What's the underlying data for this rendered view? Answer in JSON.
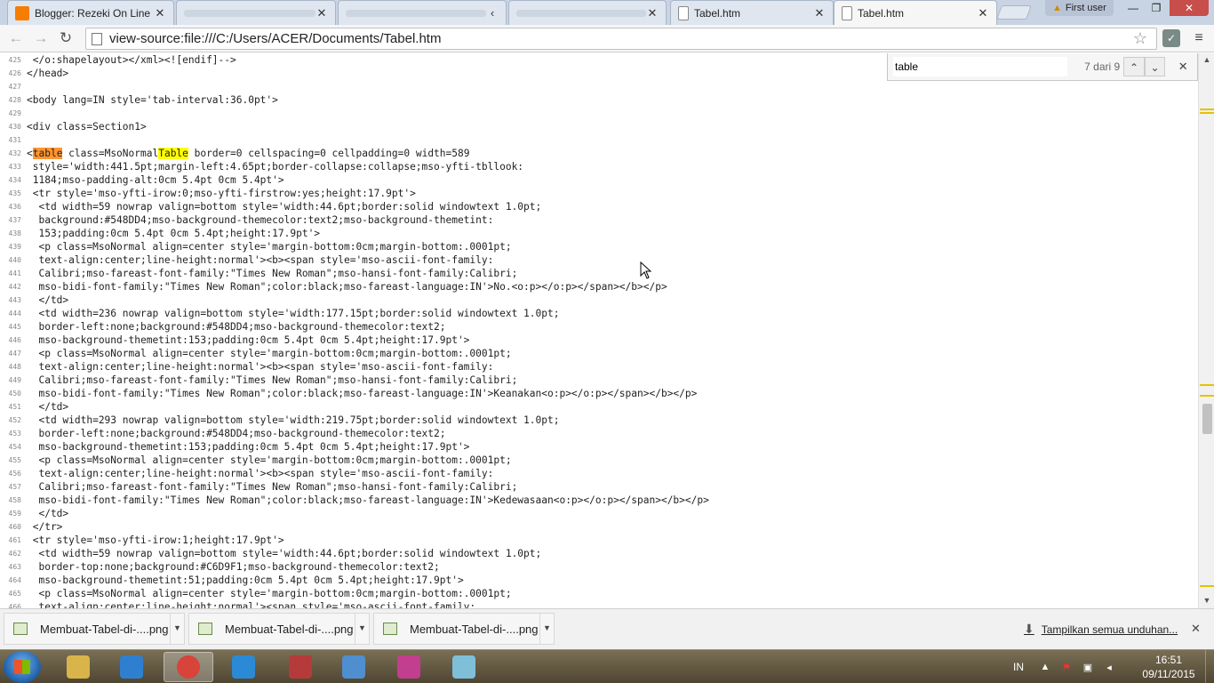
{
  "tabs": [
    {
      "title": "Blogger: Rezeki On Line",
      "icon": "blogger-icon",
      "active": false
    },
    {
      "title": "",
      "icon": "blank-icon",
      "active": false
    },
    {
      "title": "",
      "icon": "blank-icon",
      "active": false
    },
    {
      "title": "Tabel.htm",
      "icon": "page-icon",
      "active": false
    },
    {
      "title": "Tabel.htm",
      "icon": "page-icon",
      "active": true
    }
  ],
  "user_badge": "First user",
  "window_controls": {
    "minimize": "—",
    "maximize": "❐",
    "close": "✕"
  },
  "address": "view-source:file:///C:/Users/ACER/Documents/Tabel.htm",
  "find": {
    "query": "table",
    "count": "7 dari 9"
  },
  "highlight_colors": {
    "current": "#ff9632",
    "other": "#ffff00"
  },
  "source_lines": [
    {
      "n": "425",
      "text": " </o:shapelayout></xml><![endif]-->"
    },
    {
      "n": "426",
      "text": "</head>"
    },
    {
      "n": "427",
      "text": ""
    },
    {
      "n": "428",
      "text": "<body lang=IN style='tab-interval:36.0pt'>"
    },
    {
      "n": "429",
      "text": ""
    },
    {
      "n": "430",
      "text": "<div class=Section1>"
    },
    {
      "n": "431",
      "text": ""
    },
    {
      "n": "432",
      "text": "<table class=MsoNormalTable border=0 cellspacing=0 cellpadding=0 width=589"
    },
    {
      "n": "433",
      "text": " style='width:441.5pt;margin-left:4.65pt;border-collapse:collapse;mso-yfti-tbllook:"
    },
    {
      "n": "434",
      "text": " 1184;mso-padding-alt:0cm 5.4pt 0cm 5.4pt'>"
    },
    {
      "n": "435",
      "text": " <tr style='mso-yfti-irow:0;mso-yfti-firstrow:yes;height:17.9pt'>"
    },
    {
      "n": "436",
      "text": "  <td width=59 nowrap valign=bottom style='width:44.6pt;border:solid windowtext 1.0pt;"
    },
    {
      "n": "437",
      "text": "  background:#548DD4;mso-background-themecolor:text2;mso-background-themetint:"
    },
    {
      "n": "438",
      "text": "  153;padding:0cm 5.4pt 0cm 5.4pt;height:17.9pt'>"
    },
    {
      "n": "439",
      "text": "  <p class=MsoNormal align=center style='margin-bottom:0cm;margin-bottom:.0001pt;"
    },
    {
      "n": "440",
      "text": "  text-align:center;line-height:normal'><b><span style='mso-ascii-font-family:"
    },
    {
      "n": "441",
      "text": "  Calibri;mso-fareast-font-family:\"Times New Roman\";mso-hansi-font-family:Calibri;"
    },
    {
      "n": "442",
      "text": "  mso-bidi-font-family:\"Times New Roman\";color:black;mso-fareast-language:IN'>No.<o:p></o:p></span></b></p>"
    },
    {
      "n": "443",
      "text": "  </td>"
    },
    {
      "n": "444",
      "text": "  <td width=236 nowrap valign=bottom style='width:177.15pt;border:solid windowtext 1.0pt;"
    },
    {
      "n": "445",
      "text": "  border-left:none;background:#548DD4;mso-background-themecolor:text2;"
    },
    {
      "n": "446",
      "text": "  mso-background-themetint:153;padding:0cm 5.4pt 0cm 5.4pt;height:17.9pt'>"
    },
    {
      "n": "447",
      "text": "  <p class=MsoNormal align=center style='margin-bottom:0cm;margin-bottom:.0001pt;"
    },
    {
      "n": "448",
      "text": "  text-align:center;line-height:normal'><b><span style='mso-ascii-font-family:"
    },
    {
      "n": "449",
      "text": "  Calibri;mso-fareast-font-family:\"Times New Roman\";mso-hansi-font-family:Calibri;"
    },
    {
      "n": "450",
      "text": "  mso-bidi-font-family:\"Times New Roman\";color:black;mso-fareast-language:IN'>Keanakan<o:p></o:p></span></b></p>"
    },
    {
      "n": "451",
      "text": "  </td>"
    },
    {
      "n": "452",
      "text": "  <td width=293 nowrap valign=bottom style='width:219.75pt;border:solid windowtext 1.0pt;"
    },
    {
      "n": "453",
      "text": "  border-left:none;background:#548DD4;mso-background-themecolor:text2;"
    },
    {
      "n": "454",
      "text": "  mso-background-themetint:153;padding:0cm 5.4pt 0cm 5.4pt;height:17.9pt'>"
    },
    {
      "n": "455",
      "text": "  <p class=MsoNormal align=center style='margin-bottom:0cm;margin-bottom:.0001pt;"
    },
    {
      "n": "456",
      "text": "  text-align:center;line-height:normal'><b><span style='mso-ascii-font-family:"
    },
    {
      "n": "457",
      "text": "  Calibri;mso-fareast-font-family:\"Times New Roman\";mso-hansi-font-family:Calibri;"
    },
    {
      "n": "458",
      "text": "  mso-bidi-font-family:\"Times New Roman\";color:black;mso-fareast-language:IN'>Kedewasaan<o:p></o:p></span></b></p>"
    },
    {
      "n": "459",
      "text": "  </td>"
    },
    {
      "n": "460",
      "text": " </tr>"
    },
    {
      "n": "461",
      "text": " <tr style='mso-yfti-irow:1;height:17.9pt'>"
    },
    {
      "n": "462",
      "text": "  <td width=59 nowrap valign=bottom style='width:44.6pt;border:solid windowtext 1.0pt;"
    },
    {
      "n": "463",
      "text": "  border-top:none;background:#C6D9F1;mso-background-themecolor:text2;"
    },
    {
      "n": "464",
      "text": "  mso-background-themetint:51;padding:0cm 5.4pt 0cm 5.4pt;height:17.9pt'>"
    },
    {
      "n": "465",
      "text": "  <p class=MsoNormal align=center style='margin-bottom:0cm;margin-bottom:.0001pt;"
    },
    {
      "n": "466",
      "text": "  text-align:center;line-height:normal'><span style='mso-ascii-font-family:"
    }
  ],
  "downloads": [
    {
      "name": "Membuat-Tabel-di-....png"
    },
    {
      "name": "Membuat-Tabel-di-....png"
    },
    {
      "name": "Membuat-Tabel-di-....png"
    }
  ],
  "download_show_all": "Tampilkan semua unduhan...",
  "taskbar": {
    "apps": [
      {
        "name": "explorer-icon",
        "color": "#d9b44a"
      },
      {
        "name": "media-player-icon",
        "color": "#2f7fd0"
      },
      {
        "name": "chrome-icon",
        "color": "#d8433a"
      },
      {
        "name": "ie-icon",
        "color": "#2a8ad6"
      },
      {
        "name": "calendar-app-icon",
        "color": "#b53b3b"
      },
      {
        "name": "control-panel-icon",
        "color": "#4f8fcf"
      },
      {
        "name": "snagit-icon",
        "color": "#c23f8f"
      },
      {
        "name": "notepad-icon",
        "color": "#7fbfd8"
      }
    ],
    "language": "IN",
    "time": "16:51",
    "date": "09/11/2015"
  }
}
